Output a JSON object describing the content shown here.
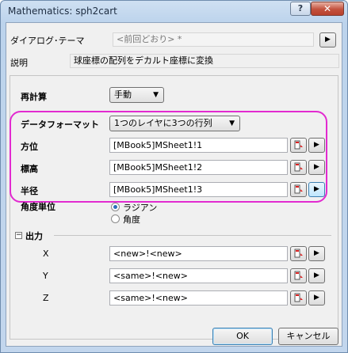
{
  "window": {
    "title": "Mathematics: sph2cart",
    "help_glyph": "?",
    "close_glyph": "✕"
  },
  "dialog_theme": {
    "label": "ダイアログ･テーマ",
    "value": "<前回どおり> *",
    "menu_glyph": "▶"
  },
  "description": {
    "label": "説明",
    "value": "球座標の配列をデカルト座標に変換"
  },
  "recalculate": {
    "label": "再計算",
    "value": "手動",
    "arrow": "▼"
  },
  "input": {
    "data_format": {
      "label": "データフォーマット",
      "value": "1つのレイヤに3つの行列",
      "arrow": "▼"
    },
    "azimuth": {
      "label": "方位",
      "value": "[MBook5]MSheet1!1"
    },
    "elevation": {
      "label": "標高",
      "value": "[MBook5]MSheet1!2"
    },
    "radius": {
      "label": "半径",
      "value": "[MBook5]MSheet1!3"
    },
    "menu_glyph": "▶"
  },
  "angle_unit": {
    "label": "角度単位",
    "options": [
      "ラジアン",
      "角度"
    ],
    "selected": "ラジアン"
  },
  "output": {
    "label": "出力",
    "collapse_glyph": "−",
    "x": {
      "label": "X",
      "value": "<new>!<new>"
    },
    "y": {
      "label": "Y",
      "value": "<same>!<new>"
    },
    "z": {
      "label": "Z",
      "value": "<same>!<new>"
    }
  },
  "buttons": {
    "ok": "OK",
    "cancel": "キャンセル"
  },
  "colors": {
    "highlight": "#e22ad0",
    "title_bar": "#c2d6ed",
    "close_button": "#c3513d"
  }
}
